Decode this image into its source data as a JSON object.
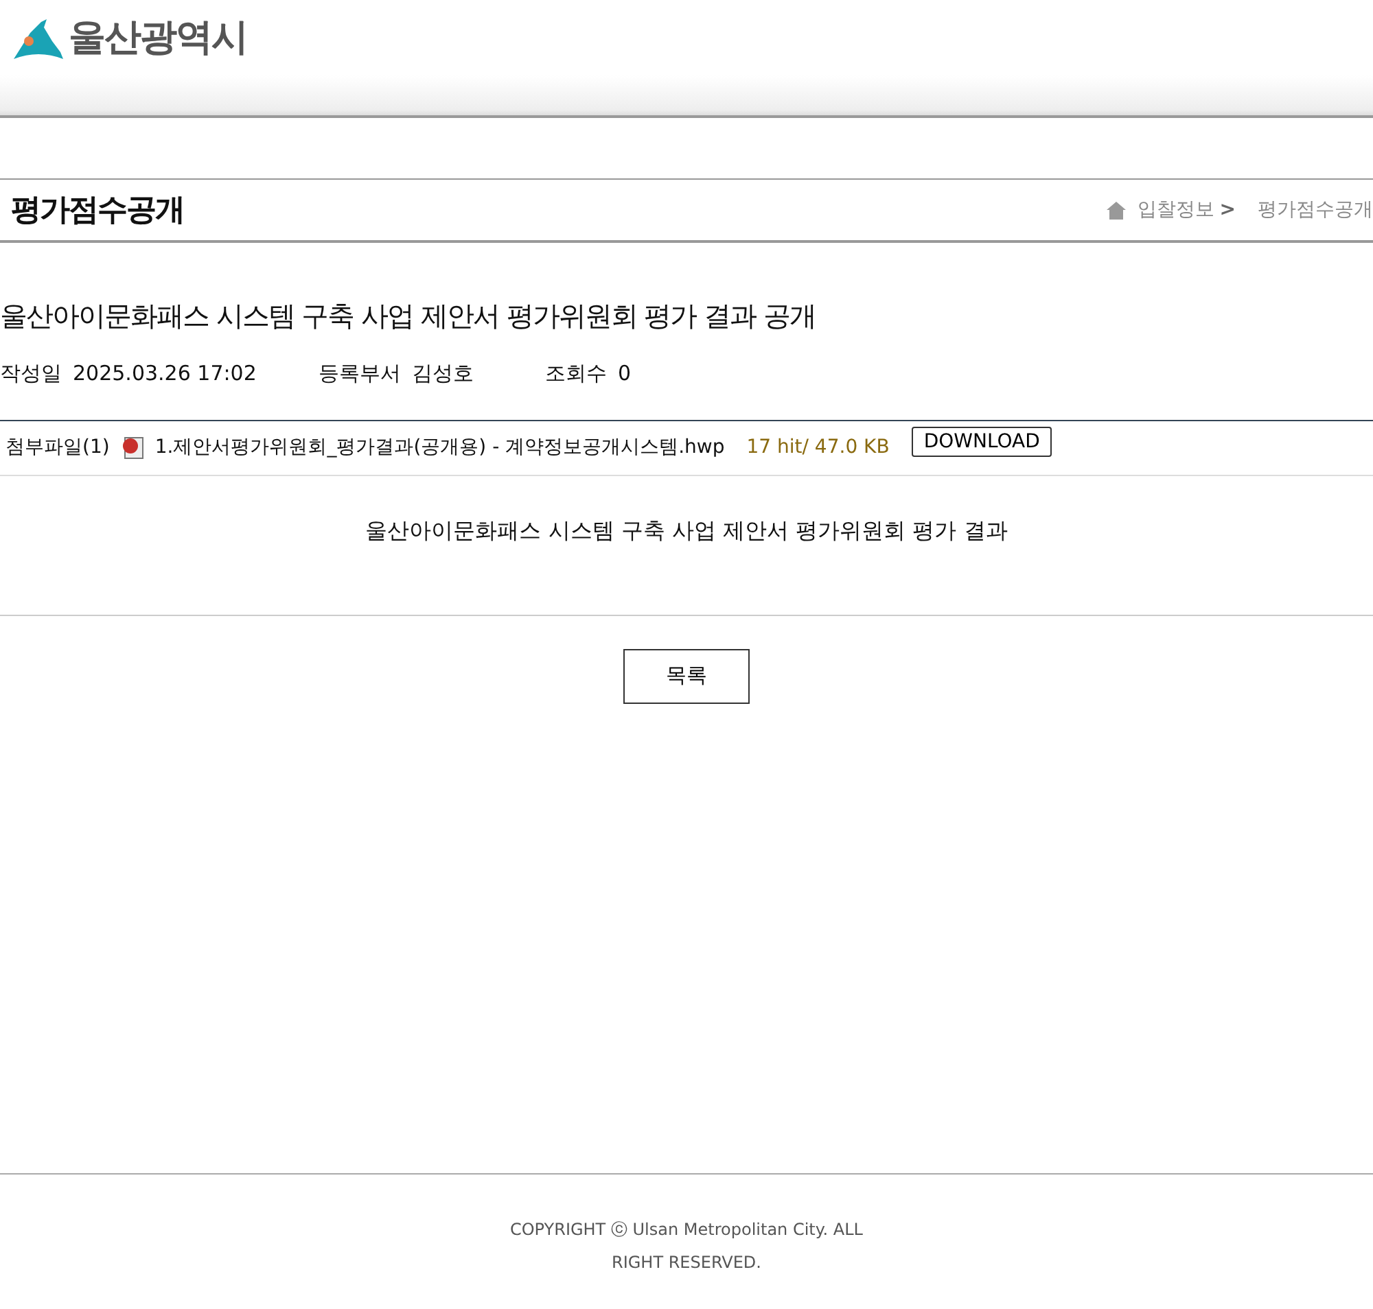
{
  "header": {
    "logo_text": "울산광역시"
  },
  "page_title": "평가점수공개",
  "breadcrumb": [
    {
      "label": "입찰정보",
      "separator": ">"
    },
    {
      "label": "평가점수공개"
    }
  ],
  "post": {
    "title": "울산아이문화패스 시스템 구축 사업 제안서 평가위원회 평가 결과 공개",
    "meta": [
      {
        "label": "작성일",
        "value": "2025.03.26 17:02"
      },
      {
        "label": "등록부서",
        "value": "김성호"
      },
      {
        "label": "조회수",
        "value": "0"
      }
    ],
    "attachment": {
      "label": "첨부파일(1)",
      "filename": "1.제안서평가위원회_평가결과(공개용) - 계약정보공개시스템.hwp",
      "info": "17 hit/ 47.0 KB",
      "button": "DOWNLOAD"
    },
    "body": "울산아이문화패스 시스템 구축 사업 제안서 평가위원회 평가 결과"
  },
  "list_button": "목록",
  "footer": {
    "copyright": "COPYRIGHT ⓒ Ulsan Metropolitan City. ALL RIGHT RESERVED."
  }
}
